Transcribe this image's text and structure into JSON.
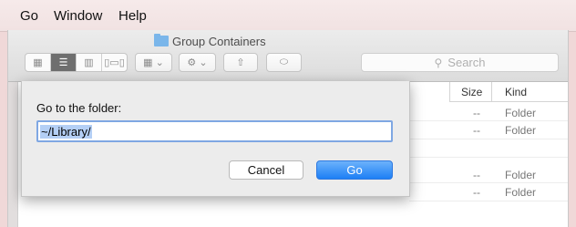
{
  "menubar": {
    "items": [
      "Go",
      "Window",
      "Help"
    ]
  },
  "window": {
    "title": "Group Containers",
    "search_placeholder": "Search",
    "columns": {
      "size": "Size",
      "kind": "Kind"
    },
    "rows": [
      {
        "size": "--",
        "kind": "Folder"
      },
      {
        "size": "--",
        "kind": "Folder"
      },
      {
        "size": "--",
        "kind": "Folder"
      },
      {
        "size": "--",
        "kind": "Folder"
      }
    ]
  },
  "dialog": {
    "label": "Go to the folder:",
    "path_value": "~/Library/",
    "cancel_label": "Cancel",
    "go_label": "Go"
  },
  "colors": {
    "accent": "#1d7ff5",
    "folder": "#7ab6ea",
    "selection": "#b4cff5"
  }
}
